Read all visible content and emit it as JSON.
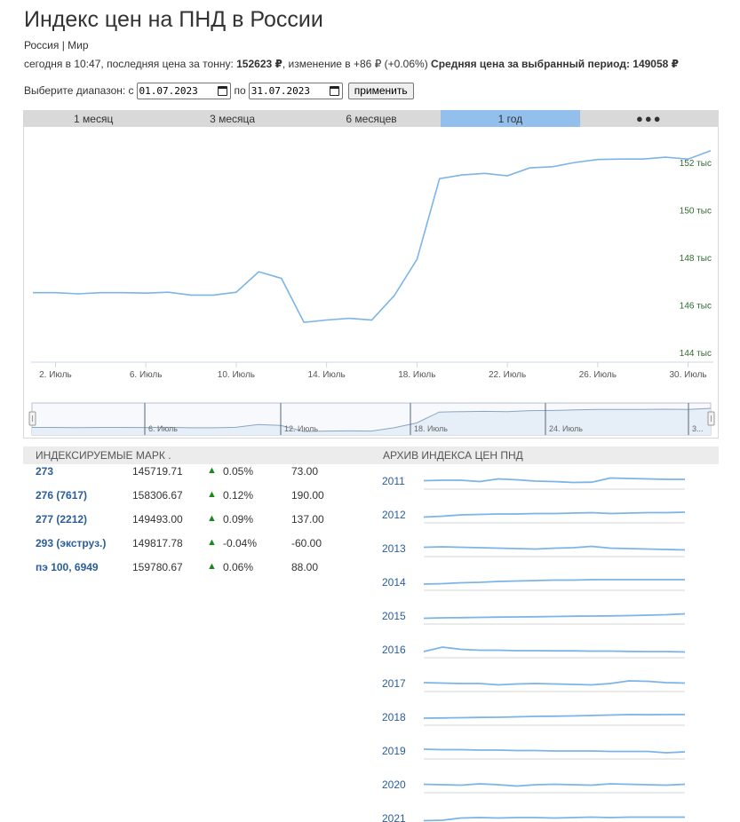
{
  "header": {
    "title": "Индекс цен на ПНД в России",
    "breadcrumb": {
      "region": "Россия",
      "separator": " | ",
      "world": "Мир"
    },
    "price_prefix": "сегодня в 10:47, последняя цена за тонну: ",
    "last_price": "152623 ₽",
    "change_text": ", изменение в +86 ₽ (+0.06%) ",
    "avg_label": "Средняя цена за выбранный период: 149058 ₽"
  },
  "range": {
    "label": "Выберите диапазон: с",
    "from": "01.07.2023",
    "to_label": "по",
    "to": "31.07.2023",
    "apply": "применить"
  },
  "tabs": [
    {
      "label": "1 месяц",
      "active": false
    },
    {
      "label": "3 месяца",
      "active": false
    },
    {
      "label": "6 месяцев",
      "active": false
    },
    {
      "label": "1 год",
      "active": true
    },
    {
      "label": "●●●",
      "active": false
    }
  ],
  "colors": {
    "line": "#7cb4e8",
    "axis_text": "#2e6b2e",
    "active_tab": "#92bfec",
    "link": "#2a5d9c",
    "up_arrow": "#1a8a1a"
  },
  "chart_data": {
    "type": "line",
    "x": [
      1,
      2,
      3,
      4,
      5,
      6,
      7,
      8,
      9,
      10,
      11,
      12,
      13,
      14,
      15,
      16,
      17,
      18,
      19,
      20,
      21,
      22,
      23,
      24,
      25,
      26,
      27,
      28,
      29,
      30,
      31
    ],
    "series": [
      {
        "values": [
          146.7,
          146.7,
          146.65,
          146.7,
          146.7,
          146.68,
          146.72,
          146.6,
          146.6,
          146.72,
          147.58,
          147.3,
          145.45,
          145.55,
          145.62,
          145.55,
          146.58,
          148.1,
          151.5,
          151.65,
          151.72,
          151.62,
          151.95,
          152.0,
          152.18,
          152.3,
          152.32,
          152.32,
          152.4,
          152.32,
          152.67
        ]
      }
    ],
    "x_ticks": [
      {
        "x": 2,
        "label": "2. Июль"
      },
      {
        "x": 6,
        "label": "6. Июль"
      },
      {
        "x": 10,
        "label": "10. Июль"
      },
      {
        "x": 14,
        "label": "14. Июль"
      },
      {
        "x": 18,
        "label": "18. Июль"
      },
      {
        "x": 22,
        "label": "22. Июль"
      },
      {
        "x": 26,
        "label": "26. Июль"
      },
      {
        "x": 30,
        "label": "30. Июль"
      }
    ],
    "y_ticks": [
      {
        "y": 144,
        "label": "144 тыс"
      },
      {
        "y": 146,
        "label": "146 тыс"
      },
      {
        "y": 148,
        "label": "148 тыс"
      },
      {
        "y": 150,
        "label": "150 тыс"
      },
      {
        "y": 152,
        "label": "152 тыс"
      }
    ],
    "xlim": [
      1,
      31
    ],
    "ylim": [
      144,
      153
    ],
    "grid": false,
    "navigator": {
      "labels": [
        "6. Июль",
        "12. Июль",
        "18. Июль",
        "24. Июль",
        "3..."
      ]
    }
  },
  "lower": {
    "grades_title": "ИНДЕКСИРУЕМЫЕ МАРК .",
    "archive_title": "АРХИВ ИНДЕКСА ЦЕН ПНД",
    "grades": [
      {
        "name": "273",
        "price": "145719.71",
        "change": "0.05%",
        "delta": "73.00"
      },
      {
        "name": "276 (7617)",
        "price": "158306.67",
        "change": "0.12%",
        "delta": "190.00"
      },
      {
        "name": "277 (2212)",
        "price": "149493.00",
        "change": "0.09%",
        "delta": "137.00"
      },
      {
        "name": "293 (экструз.)",
        "price": "149817.78",
        "change": "-0.04%",
        "delta": "-60.00"
      },
      {
        "name": "пэ 100, 6949",
        "price": "159780.67",
        "change": "0.06%",
        "delta": "88.00"
      }
    ],
    "arrow_glyph": "▲",
    "archive": [
      {
        "year": "2011",
        "trend": [
          0.55,
          0.5,
          0.5,
          0.65,
          0.35,
          0.45,
          0.6,
          0.65,
          0.75,
          0.72,
          0.25,
          0.3,
          0.35,
          0.4,
          0.4
        ]
      },
      {
        "year": "2012",
        "trend": [
          0.85,
          0.75,
          0.6,
          0.55,
          0.5,
          0.5,
          0.45,
          0.45,
          0.4,
          0.35,
          0.45,
          0.4,
          0.35,
          0.35,
          0.3
        ]
      },
      {
        "year": "2013",
        "trend": [
          0.45,
          0.4,
          0.45,
          0.5,
          0.55,
          0.6,
          0.65,
          0.55,
          0.5,
          0.35,
          0.55,
          0.6,
          0.65,
          0.7,
          0.75
        ]
      },
      {
        "year": "2014",
        "trend": [
          0.8,
          0.75,
          0.65,
          0.6,
          0.5,
          0.45,
          0.4,
          0.35,
          0.35,
          0.3,
          0.3,
          0.3,
          0.3,
          0.3,
          0.3
        ]
      },
      {
        "year": "2015",
        "trend": [
          0.85,
          0.8,
          0.78,
          0.75,
          0.72,
          0.7,
          0.68,
          0.65,
          0.62,
          0.6,
          0.58,
          0.55,
          0.5,
          0.45,
          0.35
        ]
      },
      {
        "year": "2016",
        "trend": [
          0.8,
          0.3,
          0.55,
          0.65,
          0.65,
          0.7,
          0.7,
          0.72,
          0.72,
          0.75,
          0.75,
          0.78,
          0.8,
          0.8,
          0.85
        ]
      },
      {
        "year": "2017",
        "trend": [
          0.5,
          0.55,
          0.6,
          0.6,
          0.75,
          0.65,
          0.6,
          0.65,
          0.7,
          0.75,
          0.6,
          0.3,
          0.35,
          0.5,
          0.55
        ]
      },
      {
        "year": "2018",
        "trend": [
          0.7,
          0.68,
          0.65,
          0.62,
          0.6,
          0.55,
          0.5,
          0.48,
          0.45,
          0.4,
          0.35,
          0.3,
          0.32,
          0.3,
          0.3
        ]
      },
      {
        "year": "2019",
        "trend": [
          0.4,
          0.45,
          0.45,
          0.5,
          0.5,
          0.55,
          0.55,
          0.6,
          0.6,
          0.6,
          0.65,
          0.65,
          0.65,
          0.8,
          0.7
        ]
      },
      {
        "year": "2020",
        "trend": [
          0.55,
          0.6,
          0.65,
          0.5,
          0.6,
          0.75,
          0.6,
          0.55,
          0.6,
          0.65,
          0.5,
          0.55,
          0.6,
          0.65,
          0.55
        ]
      },
      {
        "year": "2021",
        "trend": [
          0.85,
          0.8,
          0.55,
          0.5,
          0.55,
          0.5,
          0.5,
          0.55,
          0.5,
          0.45,
          0.5,
          0.45,
          0.45,
          0.45,
          0.45
        ]
      }
    ]
  }
}
